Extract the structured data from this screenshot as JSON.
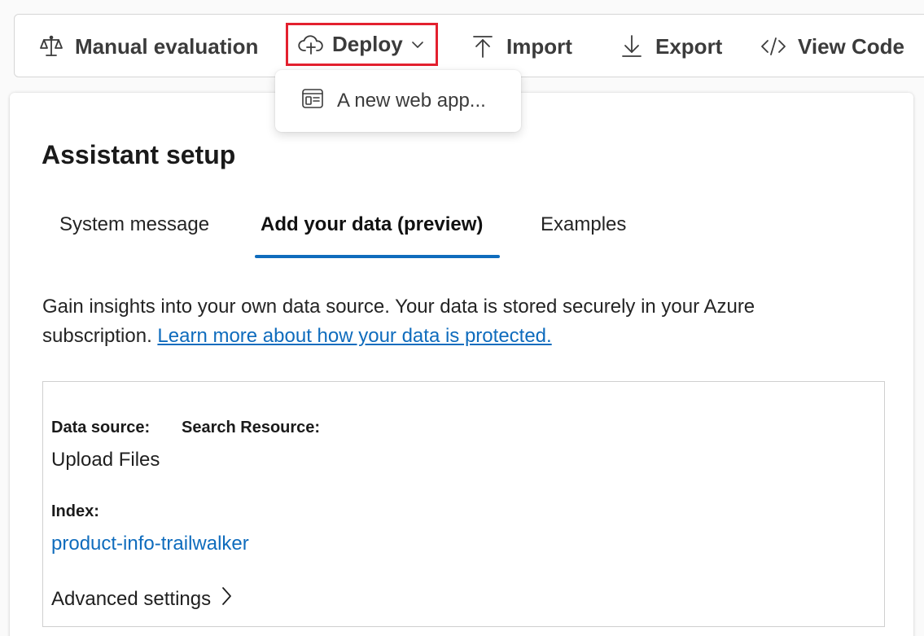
{
  "toolbar": {
    "manual_evaluation": {
      "label": "Manual evaluation",
      "icon": "scale-icon"
    },
    "deploy": {
      "label": "Deploy",
      "icon": "cloud-upload-icon",
      "highlight_color": "#e3202e"
    },
    "import": {
      "label": "Import",
      "icon": "arrow-upload-icon"
    },
    "export": {
      "label": "Export",
      "icon": "arrow-download-icon"
    },
    "view_code": {
      "label": "View Code",
      "icon": "code-icon"
    }
  },
  "deploy_menu": {
    "items": [
      {
        "label": "A new web app...",
        "icon": "web-app-icon"
      }
    ]
  },
  "card": {
    "title": "Assistant setup",
    "tabs": [
      {
        "label": "System message",
        "selected": false
      },
      {
        "label": "Add your data (preview)",
        "selected": true
      },
      {
        "label": "Examples",
        "selected": false
      }
    ],
    "description": "Gain insights into your own data source. Your data is stored securely in your Azure subscription.",
    "learn_more_link": "Learn more about how your data is protected.",
    "data": {
      "data_source_label": "Data source:",
      "search_resource_label": "Search Resource:",
      "data_source_value": "Upload Files",
      "index_label": "Index:",
      "index_value": "product-info-trailwalker",
      "advanced_settings": "Advanced settings"
    }
  },
  "colors": {
    "accent": "#0f6cbd",
    "highlight": "#e3202e"
  }
}
